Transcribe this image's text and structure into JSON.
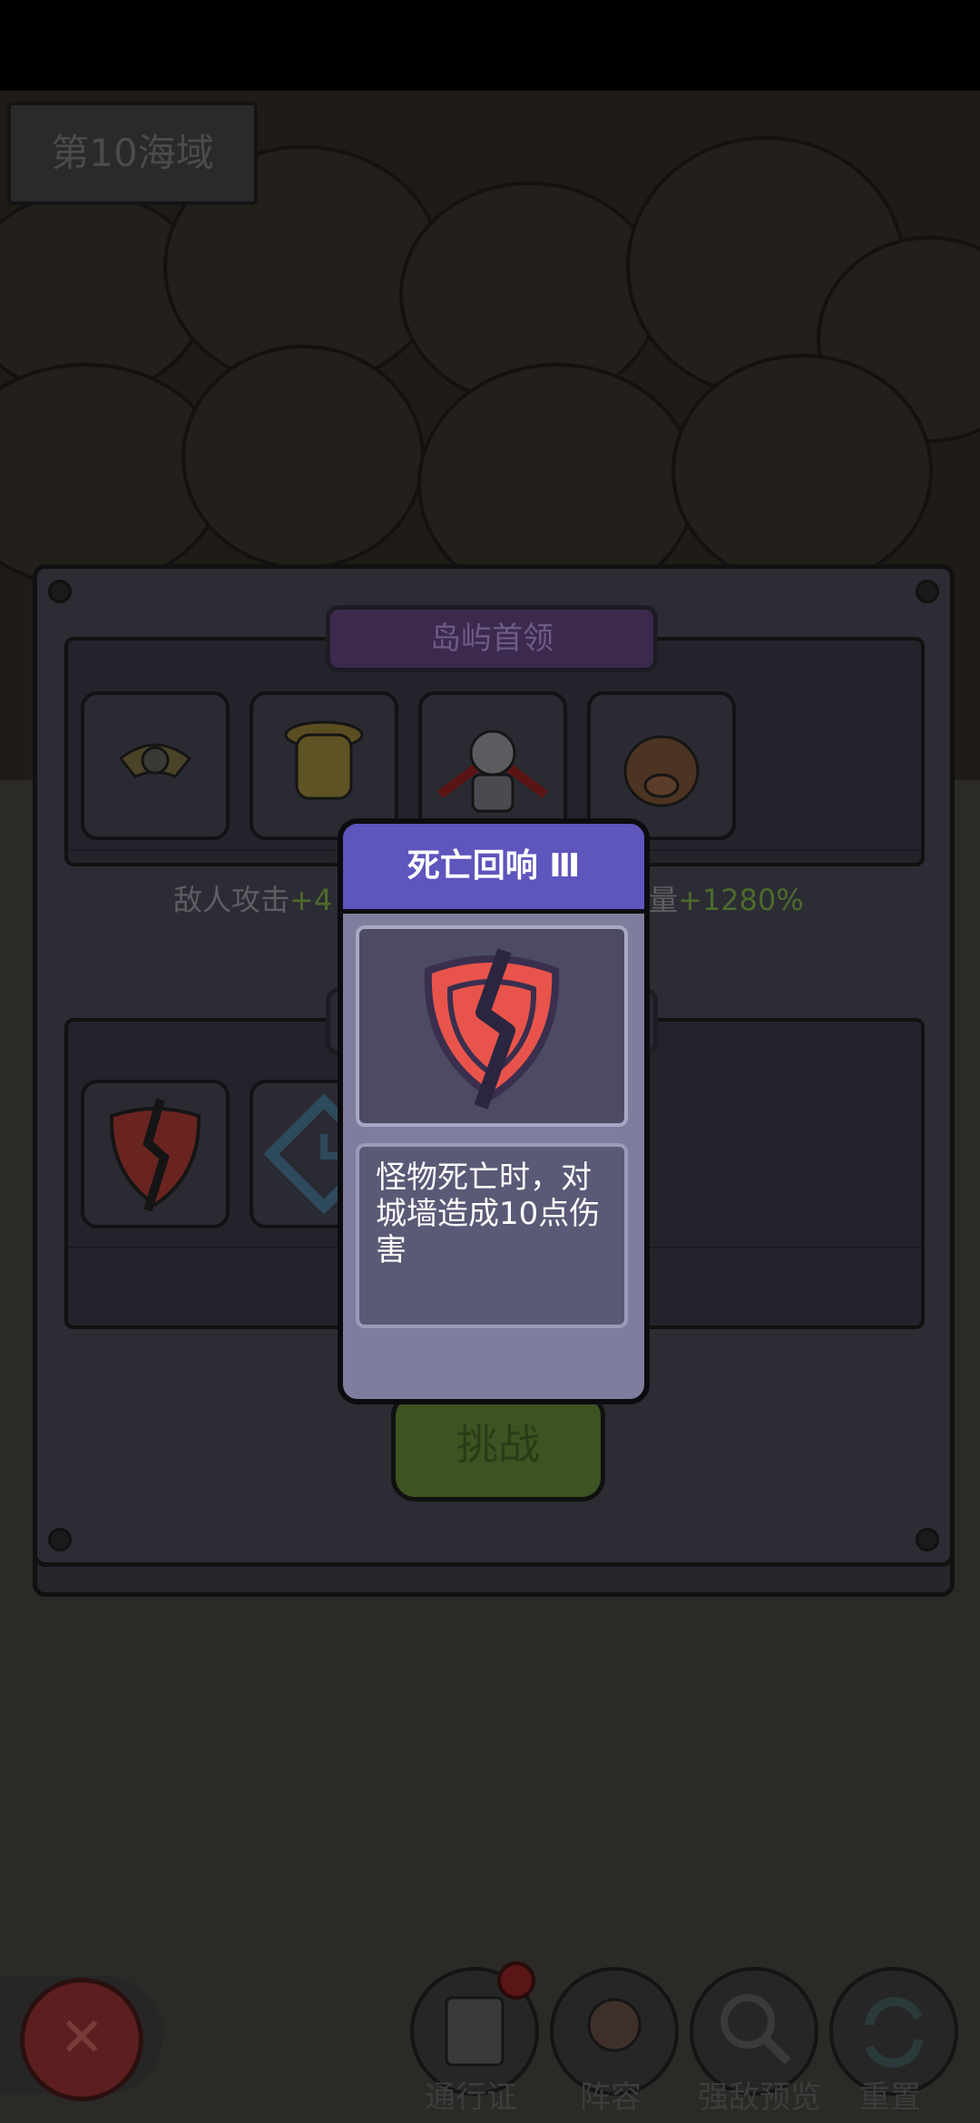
{
  "sea_zone": "第10海域",
  "boss_section": {
    "title": "岛屿首领",
    "stats_prefix": "敌人攻击",
    "stats_attack_value": "+4",
    "stats_suffix": "量",
    "stats_hp_value": "+1280%"
  },
  "challenge_label": "挑战",
  "popup": {
    "title": "死亡回响 Ⅲ",
    "description": "怪物死亡时，对城墙造成10点伤害"
  },
  "bottom_nav": [
    {
      "label": "通行证",
      "icon": "passport-icon"
    },
    {
      "label": "阵容",
      "icon": "lineup-icon"
    },
    {
      "label": "强敌预览",
      "icon": "magnifier-icon"
    },
    {
      "label": "重置",
      "icon": "reset-icon"
    }
  ],
  "close_label": "✕",
  "colors": {
    "popup_header": "#5e55bd",
    "popup_body": "#7e7d9d",
    "shield_red": "#e8544b",
    "green_value": "#4d6a2c"
  }
}
